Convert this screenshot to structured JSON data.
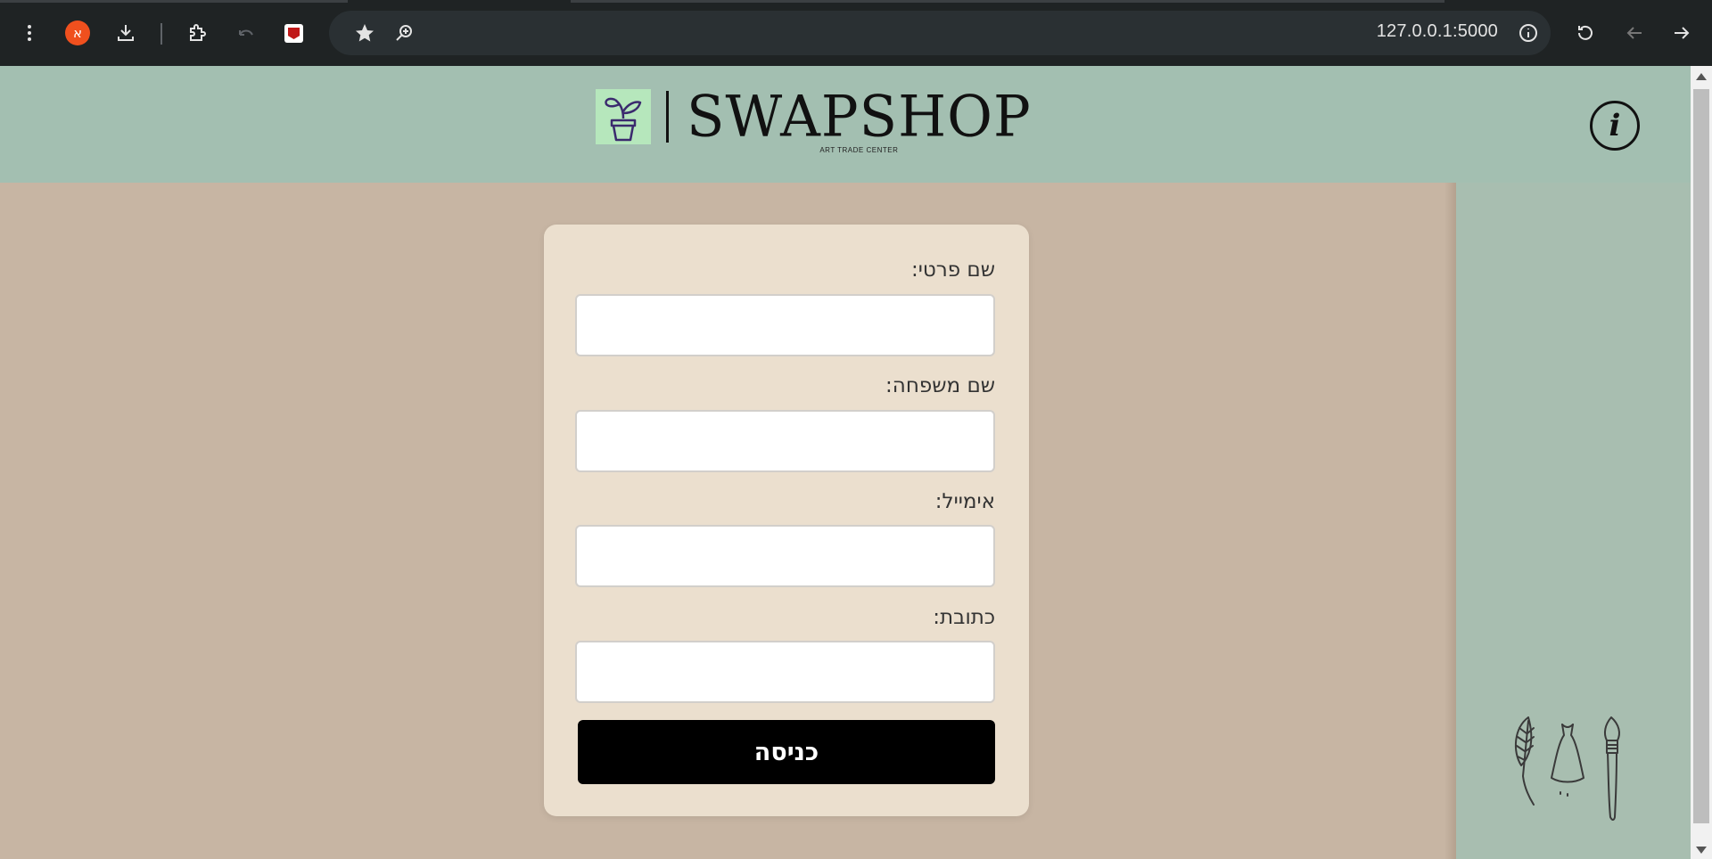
{
  "browser": {
    "url": "127.0.0.1:5000",
    "profile_initial": "א"
  },
  "brand": {
    "name": "SWAPSHOP",
    "tagline": "ART TRADE CENTER",
    "info_label": "i"
  },
  "form": {
    "first_name_label": "שם פרטי:",
    "last_name_label": "שם משפחה:",
    "email_label": "אימייל:",
    "address_label": "כתובת:",
    "first_name_value": "",
    "last_name_value": "",
    "email_value": "",
    "address_value": "",
    "submit_label": "כניסה"
  },
  "colors": {
    "header_bg": "#a3bfb1",
    "page_bg": "#c7b5a3",
    "card_bg": "#ebdfce",
    "button_bg": "#000000",
    "logo_plant_bg": "#b6e7bc"
  },
  "icons": [
    "menu-icon",
    "profile-avatar",
    "download-icon",
    "extensions-icon",
    "undo-icon",
    "mcafee-icon",
    "bookmark-star-icon",
    "zoom-icon",
    "site-info-icon",
    "reload-icon",
    "back-icon",
    "forward-icon",
    "plant-pot-icon",
    "leaf-icon",
    "dress-icon",
    "paintbrush-icon"
  ]
}
